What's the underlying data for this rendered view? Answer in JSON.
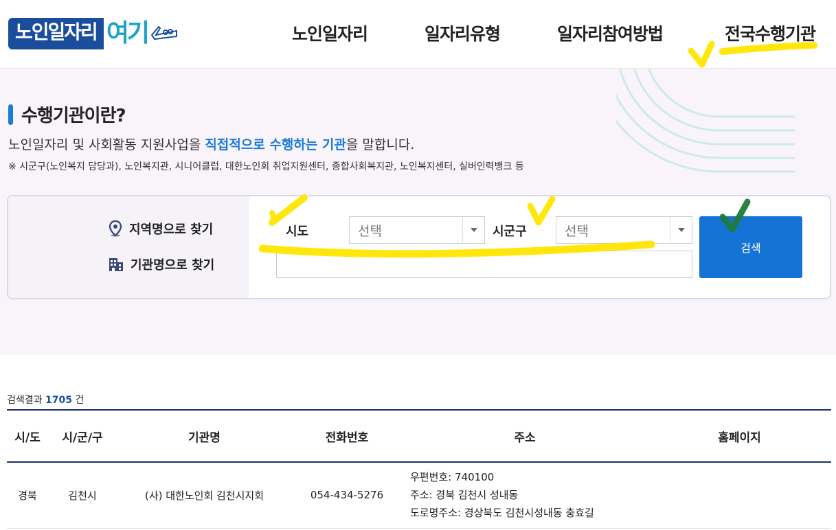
{
  "logo": {
    "main": "노인일자리",
    "sub": "여기"
  },
  "nav": [
    "노인일자리",
    "일자리유형",
    "일자리참여방법",
    "전국수행기관"
  ],
  "intro": {
    "title": "수행기관이란?",
    "desc_pre": "노인일자리 및 사회활동 지원사업을 ",
    "desc_strong": "직접적으로 수행하는 기관",
    "desc_post": "을 말합니다.",
    "note": "※ 시군구(노인복지 담당과), 노인복지관, 시니어클럽, 대한노인회 취업지원센터, 종합사회복지관, 노인복지센터, 실버인력뱅크 등"
  },
  "search": {
    "by_region": "지역명으로 찾기",
    "by_org": "기관명으로 찾기",
    "sido_label": "시도",
    "sigungu_label": "시군구",
    "sido_value": "선택",
    "sigungu_value": "선택",
    "org_placeholder": "",
    "button": "검색"
  },
  "results": {
    "label_pre": "검색결과 ",
    "count": "1705",
    "label_post": " 건",
    "headers": [
      "시/도",
      "시/군/구",
      "기관명",
      "전화번호",
      "주소",
      "홈페이지"
    ],
    "rows": [
      {
        "sido": "경북",
        "sigungu": "김천시",
        "org": "(사) 대한노인회 김천시지회",
        "phone": "054-434-5276",
        "postal": "우편번호:  740100",
        "address": "주소:  경북 김천시 성내동",
        "road": "도로명주소:  경상북도 김천시성내동 충효길",
        "homepage": ""
      }
    ]
  },
  "colors": {
    "brand": "#1a4e9c",
    "accent": "#1a7bd9",
    "button": "#1573d6",
    "highlight": "#ffe600"
  }
}
